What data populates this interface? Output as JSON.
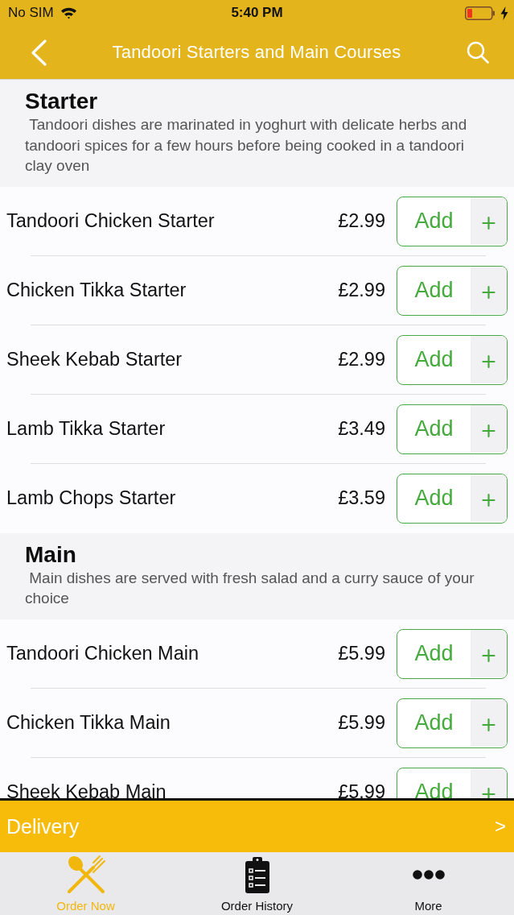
{
  "status_bar": {
    "carrier": "No SIM",
    "time": "5:40 PM"
  },
  "nav_bar": {
    "title": "Tandoori Starters and Main Courses"
  },
  "sections": [
    {
      "title": "Starter",
      "description": " Tandoori dishes are marinated in yoghurt with delicate herbs and tandoori spices for a few hours before being cooked in a tandoori clay oven",
      "items": [
        {
          "name": "Tandoori Chicken Starter",
          "price": "£2.99",
          "button": "Add"
        },
        {
          "name": "Chicken Tikka Starter",
          "price": "£2.99",
          "button": "Add"
        },
        {
          "name": "Sheek Kebab Starter",
          "price": "£2.99",
          "button": "Add"
        },
        {
          "name": "Lamb Tikka Starter",
          "price": "£3.49",
          "button": "Add"
        },
        {
          "name": "Lamb Chops Starter",
          "price": "£3.59",
          "button": "Add"
        }
      ]
    },
    {
      "title": "Main",
      "description": " Main dishes are served with fresh salad and a curry sauce of your choice",
      "items": [
        {
          "name": "Tandoori Chicken Main",
          "price": "£5.99",
          "button": "Add"
        },
        {
          "name": "Chicken Tikka Main",
          "price": "£5.99",
          "button": "Add"
        },
        {
          "name": "Sheek Kebab Main",
          "price": "£5.99",
          "button": "Add"
        }
      ]
    }
  ],
  "delivery_bar": {
    "label": "Delivery",
    "arrow": ">"
  },
  "tabs": [
    {
      "label": "Order Now",
      "selected": true
    },
    {
      "label": "Order History",
      "selected": false
    },
    {
      "label": "More",
      "selected": false
    }
  ]
}
